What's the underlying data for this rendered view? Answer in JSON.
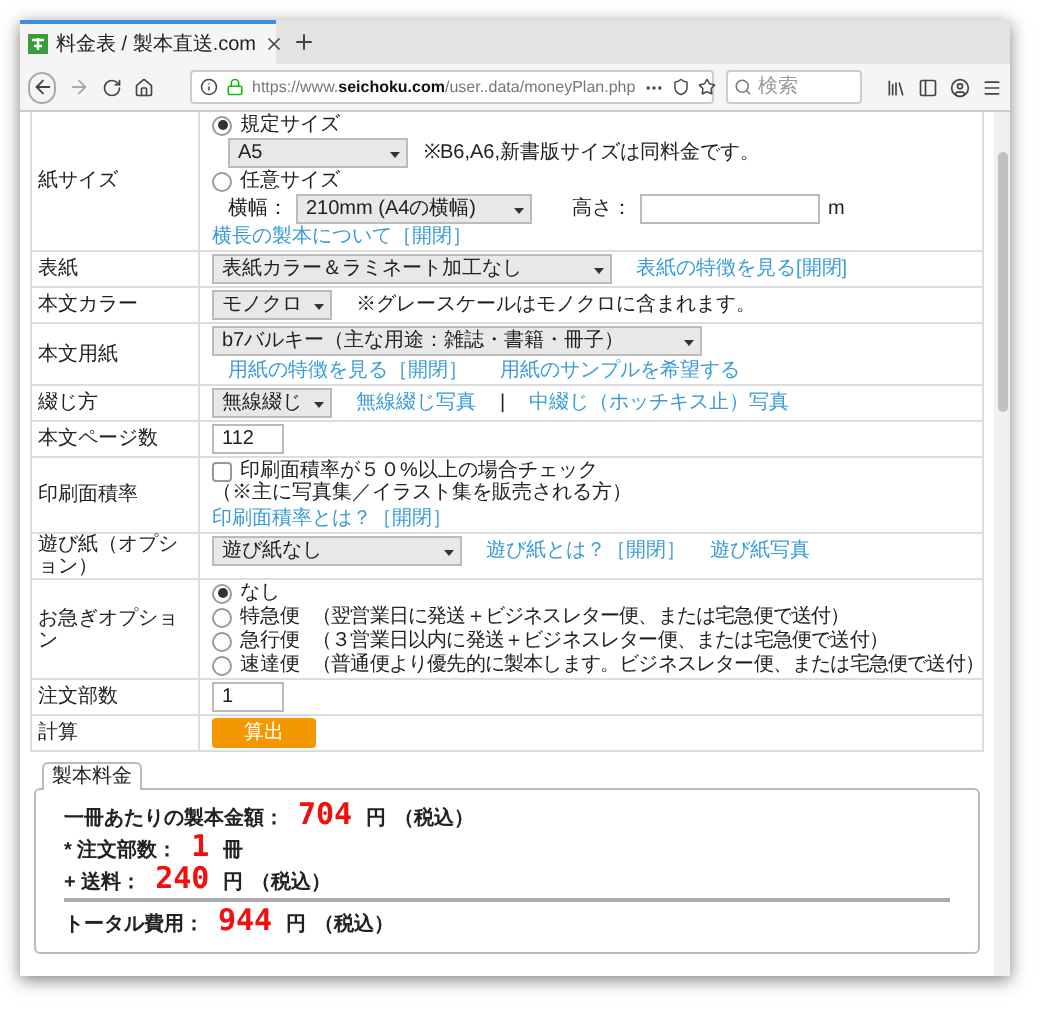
{
  "browser": {
    "tab_title": "料金表 / 製本直送.com",
    "url_prefix": "https://www.",
    "url_domain": "seichoku.com",
    "url_path": "/user..data/moneyPlan.php",
    "search": {
      "placeholder": "検索"
    }
  },
  "form": {
    "rows": [
      {
        "kind": "paper_size",
        "label": "紙サイズ",
        "options": [
          {
            "label": "規定サイズ",
            "selected": true
          },
          {
            "label": "任意サイズ",
            "selected": false
          }
        ],
        "size_select": "A5",
        "size_note": "※B6,A6,新書版サイズは同料金です。",
        "width_label": "横幅：",
        "width_select": "210mm (A4の横幅)",
        "height_label": "高さ：",
        "height_unit": "m",
        "link": "横長の製本について［開閉］"
      },
      {
        "kind": "select",
        "label": "表紙",
        "select": "表紙カラー＆ラミネート加工なし",
        "links": [
          "表紙の特徴を見る[開閉]"
        ]
      },
      {
        "kind": "select",
        "label": "本文カラー",
        "select": "モノクロ",
        "note": "※グレースケールはモノクロに含まれます。"
      },
      {
        "kind": "select_stacked",
        "label": "本文用紙",
        "select": "b7バルキー（主な用途：雑誌・書籍・冊子）",
        "links": [
          "用紙の特徴を見る［開閉］",
          "用紙のサンプルを希望する"
        ]
      },
      {
        "kind": "select",
        "label": "綴じ方",
        "select": "無線綴じ",
        "links": [
          "無線綴じ写真",
          "中綴じ（ホッチキス止）写真"
        ],
        "separator": "|"
      },
      {
        "kind": "input",
        "label": "本文ページ数",
        "value": "112"
      },
      {
        "kind": "checkbox",
        "label": "印刷面積率",
        "checked": false,
        "text": "印刷面積率が５０%以上の場合チェック",
        "note": "（※主に写真集／イラスト集を販売される方）",
        "link": "印刷面積率とは？［開閉］"
      },
      {
        "kind": "select",
        "label": "遊び紙（オプション）",
        "select": "遊び紙なし",
        "links": [
          "遊び紙とは？［開閉］",
          "遊び紙写真"
        ]
      },
      {
        "kind": "radio",
        "label": "お急ぎオプション",
        "options": [
          {
            "label": "なし",
            "selected": true
          },
          {
            "label": "特急便",
            "note": "（翌営業日に発送＋ビジネスレター便、または宅急便で送付）",
            "selected": false
          },
          {
            "label": "急行便",
            "note": "（３営業日以内に発送＋ビジネスレター便、または宅急便で送付）",
            "selected": false
          },
          {
            "label": "速達便",
            "note": "（普通便より優先的に製本します。ビジネスレター便、または宅急便で送付）",
            "selected": false
          }
        ]
      },
      {
        "kind": "input",
        "label": "注文部数",
        "value": "1"
      },
      {
        "kind": "button",
        "label": "計算",
        "button": "算出"
      }
    ]
  },
  "result": {
    "tab": "製本料金",
    "lines": [
      {
        "kind": "line",
        "prefix": "一冊あたりの製本金額：",
        "amount": "704",
        "unit": "円",
        "note": "（税込）"
      },
      {
        "kind": "line",
        "prefix": "* 注文部数：",
        "amount": "1",
        "unit": "冊"
      },
      {
        "kind": "line",
        "prefix": "+ 送料：",
        "amount": "240",
        "unit": "円",
        "note": "（税込）"
      },
      {
        "kind": "total",
        "prefix": "トータル費用：",
        "amount": "944",
        "unit": "円",
        "note": "（税込）"
      }
    ]
  }
}
